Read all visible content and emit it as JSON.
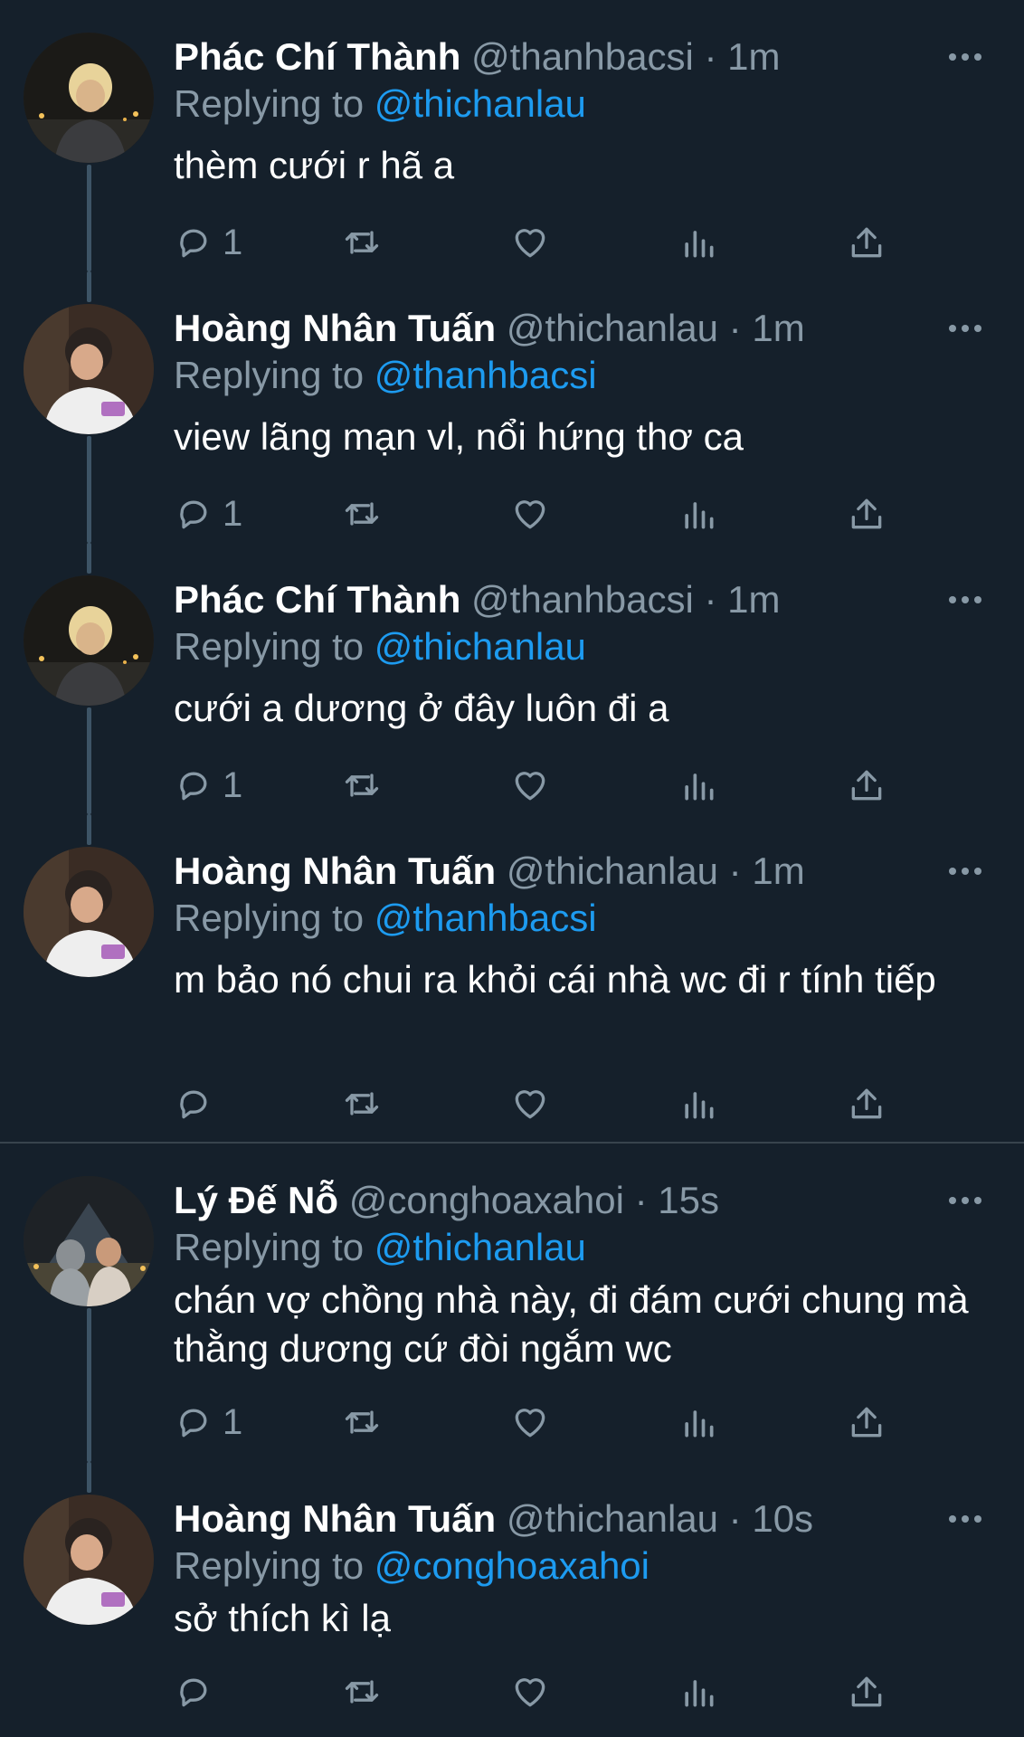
{
  "colors": {
    "background": "#15202b",
    "text": "#ffffff",
    "muted": "#8899a6",
    "mention": "#1d9bf0",
    "thread_line": "#3d5466"
  },
  "tweets": [
    {
      "name": "Phác Chí Thành",
      "handle": "@thanhbacsi",
      "dot": "·",
      "time": "1m",
      "replying_label": "Replying to",
      "replying_to": "@thichanlau",
      "text": "thèm cưới r hã a",
      "reply_count": "1"
    },
    {
      "name": "Hoàng Nhân Tuấn",
      "handle": "@thichanlau",
      "dot": "·",
      "time": "1m",
      "replying_label": "Replying to",
      "replying_to": "@thanhbacsi",
      "text": "view lãng mạn vl, nổi hứng thơ ca",
      "reply_count": "1"
    },
    {
      "name": "Phác Chí Thành",
      "handle": "@thanhbacsi",
      "dot": "·",
      "time": "1m",
      "replying_label": "Replying to",
      "replying_to": "@thichanlau",
      "text": "cưới a dương ở đây luôn đi a",
      "reply_count": "1"
    },
    {
      "name": "Hoàng Nhân Tuấn",
      "handle": "@thichanlau",
      "dot": "·",
      "time": "1m",
      "replying_label": "Replying to",
      "replying_to": "@thanhbacsi",
      "text": "m bảo nó chui ra khỏi cái nhà wc đi r tính tiếp",
      "reply_count": ""
    },
    {
      "name": "Lý Đế Nỗ",
      "handle": "@conghoaxahoi",
      "dot": "·",
      "time": "15s",
      "replying_label": "Replying to",
      "replying_to": "@thichanlau",
      "text": "chán vợ chồng nhà này, đi đám cưới chung mà thằng dương cứ đòi ngắm wc",
      "reply_count": "1"
    },
    {
      "name": "Hoàng Nhân Tuấn",
      "handle": "@thichanlau",
      "dot": "·",
      "time": "10s",
      "replying_label": "Replying to",
      "replying_to": "@conghoaxahoi",
      "text": "sở thích kì lạ",
      "reply_count": ""
    }
  ]
}
